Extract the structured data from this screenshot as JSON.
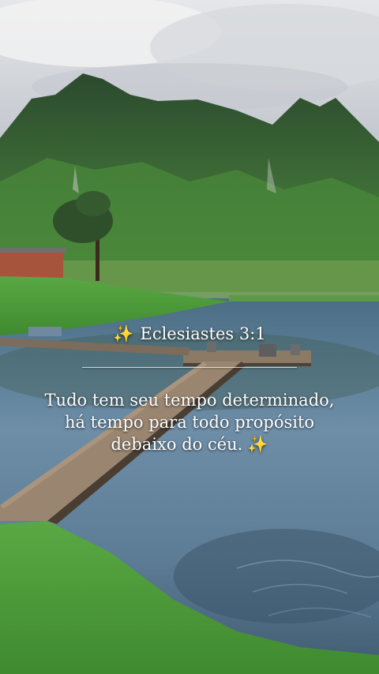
{
  "reference": {
    "sparkle": "✨",
    "text": "Eclesiastes 3:1"
  },
  "verse": {
    "lines": [
      "Tudo tem seu tempo determinado,",
      "há tempo para todo propósito",
      "debaixo do céu."
    ],
    "sparkle": "✨"
  },
  "colors": {
    "text": "#ffffff",
    "sparkle": "#ffd84a",
    "grass": "#4f9a3a",
    "water": "#5f7f98",
    "sky": "#c9ccd0",
    "mountain": "#2f5a32"
  },
  "icons": {
    "sparkle": "sparkles-icon"
  }
}
